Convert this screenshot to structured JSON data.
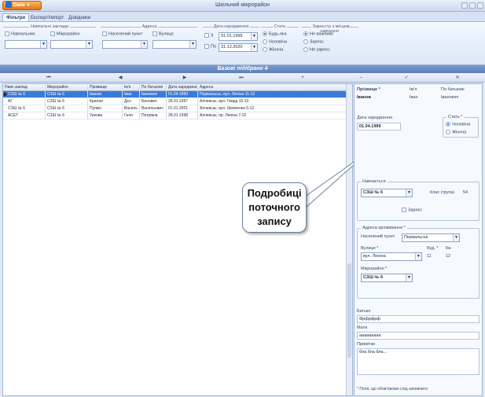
{
  "window": {
    "app_button": "Dane",
    "title": "Шкільний мікрорайон"
  },
  "tabs": [
    "Фільтри",
    "Експорт/Імпорт",
    "Довідники"
  ],
  "ribbon": {
    "group_school": {
      "title": "Навчальні заклади",
      "checkboxes": [
        "Навчальних",
        "Мікрорайон"
      ]
    },
    "group_address": {
      "title": "Адреса",
      "checkboxes": [
        "Населений пункт",
        "Вулиця"
      ]
    },
    "group_birth": {
      "title": "Дата народження",
      "from_label": "З",
      "to_label": "По",
      "from_value": "01.01.1995",
      "to_value": "31.12.2020"
    },
    "group_sex": {
      "title": "Стать",
      "options": [
        "Будь-яка",
        "Чоловіча",
        "Жіноча"
      ],
      "selected": 0
    },
    "group_study": {
      "title": "Зареєстр з місцем навчання",
      "options": [
        "Не важливо",
        "Зареєс",
        "Не зареєс"
      ],
      "selected": 0
    }
  },
  "caption": "Базові підібрано 4",
  "nav": [
    "⏮",
    "◀",
    "▶",
    "⏭",
    "+",
    "−",
    "✓",
    "✕"
  ],
  "grid": {
    "columns": [
      "Навч.заклад",
      "Мікрорайон",
      "Прізвище",
      "Ім'я",
      "По батькові",
      "Дата народження",
      "Адреса"
    ],
    "rows": [
      [
        "СЗШ № 6",
        "СЗШ № 6",
        "Іванов",
        "Іван",
        "Іванович",
        "01.04.1999",
        "Первальськ, вул. Леніна 11-12"
      ],
      [
        "АГ",
        "СЗШ № 6",
        "Крилов",
        "Дєн",
        "Бенович",
        "28.01.1997",
        "Алчевськ, вул. Гвард 15-10"
      ],
      [
        "СЗШ № 6",
        "СЗШ № 6",
        "Пупкін",
        "Василь",
        "Васильович",
        "01.01.2001",
        "Алчевськ, вул. Шевченка 5-12"
      ],
      [
        "АСЕТ",
        "СЗШ № 6",
        "Уркова",
        "Галя",
        "Петрівна",
        "28.01.1998",
        "Алчевськ, пр. Леніна 7-22"
      ]
    ],
    "selected_row": 0
  },
  "detail": {
    "surname_label": "Прізвище *",
    "name_label": "Ім'я",
    "patronymic_label": "По батькові",
    "surname": "Іванов",
    "name": "Іван",
    "patronymic": "Іванович",
    "birth_label": "Дата народження",
    "birth_value": "01.04.1999",
    "sex_legend": "Стать *",
    "sex_options": [
      "Чоловіча",
      "Жіноча"
    ],
    "sex_selected": 0,
    "study_legend": "Навчається",
    "study_school": "СЗШ № 6",
    "class_label": "Клас (група)",
    "class_value": "54",
    "registered_label": "Зареєс",
    "address_legend": "Адреса проживання *",
    "locality_label": "Населений пункт",
    "locality_value": "Первальськ",
    "street_label": "Вулиця *",
    "street_value": "вул. Леніна",
    "house_label": "Буд. *",
    "house_value": "11",
    "flat_label": "Кв.",
    "flat_value": "12",
    "district_label": "Мікрорайон *",
    "district_value": "СЗШ № 6",
    "father_label": "Батько",
    "father_value": "Фрфрфрф",
    "mother_label": "Мати",
    "mother_value": "ааааааааа",
    "notes_label": "Примітки",
    "notes_value": "бла бла бла...",
    "footer_note": "* Поля, що обов'язково слід заповнити"
  },
  "callout": {
    "lines": [
      "Подробиці",
      "поточного",
      "запису"
    ]
  }
}
